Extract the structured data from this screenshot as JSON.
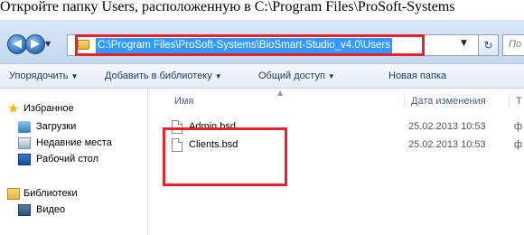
{
  "caption": "Откройте папку Users, расположенную в C:\\Program Files\\ProSoft-Systems",
  "address_bar": {
    "back_glyph": "◀",
    "forward_glyph": "▶",
    "path": "C:\\Program Files\\ProSoft-Systems\\BioSmart-Studio_v4.0\\Users",
    "dropdown_glyph": "▼",
    "refresh_glyph": "↻",
    "search_placeholder": "По"
  },
  "toolbar": {
    "organize": "Упорядочить",
    "add_to_library": "Добавить в библиотеку",
    "share": "Общий доступ",
    "new_folder": "Новая папка",
    "arrow": "▼"
  },
  "nav_pane": {
    "favorites_label": "Избранное",
    "downloads_label": "Загрузки",
    "recent_label": "Недавние места",
    "desktop_label": "Рабочий стол",
    "libraries_label": "Библиотеки",
    "video_label": "Видео"
  },
  "columns": {
    "name": "Имя",
    "date_modified": "Дата изменения",
    "type": "Т"
  },
  "files": [
    {
      "name": "Admin.bsd",
      "date": "25.02.2013 10:53",
      "type": "ф"
    },
    {
      "name": "Clients.bsd",
      "date": "25.02.2013 10:53",
      "type": "ф"
    }
  ],
  "icons": {
    "back": "back-arrow-icon",
    "forward": "forward-arrow-icon",
    "folder": "folder-icon",
    "refresh": "refresh-icon",
    "favorites": "star-icon",
    "downloads": "downloads-folder-icon",
    "recent": "recent-places-icon",
    "desktop": "desktop-icon",
    "libraries": "libraries-icon",
    "video": "video-library-icon",
    "file": "file-icon"
  },
  "colors": {
    "highlight_box": "#e8222b",
    "selection": "#3399ff",
    "toolbar_text": "#1e395b"
  }
}
